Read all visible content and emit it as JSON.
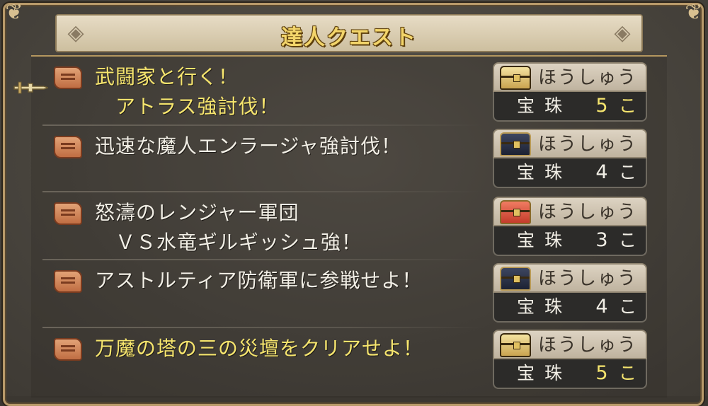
{
  "window": {
    "title": "達人クエスト"
  },
  "quests": [
    {
      "title_line1": "武闘家と行く！",
      "title_line2": "　アトラス強討伐！",
      "highlight": true,
      "reward_label": "ほうしゅう",
      "reward_item": "宝珠",
      "reward_count": "5",
      "reward_unit": "こ",
      "chest": "gold-chest-icon"
    },
    {
      "title_line1": "迅速な魔人エンラージャ強討伐！",
      "title_line2": "",
      "highlight": false,
      "reward_label": "ほうしゅう",
      "reward_item": "宝珠",
      "reward_count": "4",
      "reward_unit": "こ",
      "chest": "dark-chest-icon"
    },
    {
      "title_line1": "怒濤のレンジャー軍団",
      "title_line2": "　ＶＳ水竜ギルギッシュ強！",
      "highlight": false,
      "reward_label": "ほうしゅう",
      "reward_item": "宝珠",
      "reward_count": "3",
      "reward_unit": "こ",
      "chest": "red-chest-icon"
    },
    {
      "title_line1": "アストルティア防衛軍に参戦せよ！",
      "title_line2": "",
      "highlight": false,
      "reward_label": "ほうしゅう",
      "reward_item": "宝珠",
      "reward_count": "4",
      "reward_unit": "こ",
      "chest": "dark-chest-icon"
    },
    {
      "title_line1": "万魔の塔の三の災壇をクリアせよ！",
      "title_line2": "",
      "highlight": true,
      "reward_label": "ほうしゅう",
      "reward_item": "宝珠",
      "reward_count": "5",
      "reward_unit": "こ",
      "chest": "gold-chest-icon"
    }
  ],
  "colors": {
    "highlight_text": "#f6e56e",
    "normal_text": "#f2efe6",
    "title_gold": "#f3d56a"
  },
  "selected_index": 0
}
